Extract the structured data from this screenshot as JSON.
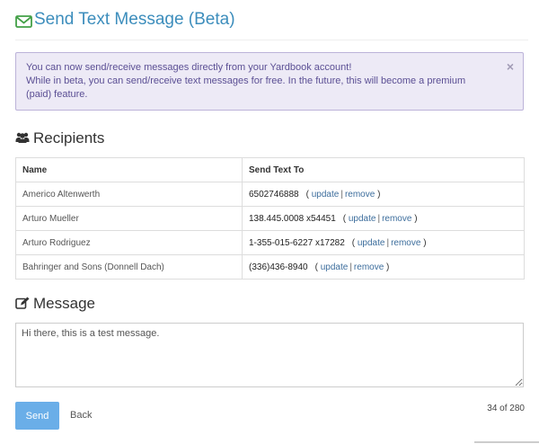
{
  "header": {
    "title": "Send Text Message (Beta)",
    "icon": "envelope-icon",
    "icon_color": "#43a047",
    "title_color": "#3c8dbc"
  },
  "alert": {
    "lines": [
      "You can now send/receive messages directly from your Yardbook account!",
      "While in beta, you can send/receive text messages for free. In the future, this will become a premium (paid) feature."
    ],
    "close_symbol": "×",
    "background": "#edeaf6",
    "text_color": "#5b4f94"
  },
  "recipients": {
    "title": "Recipients",
    "icon": "users-icon",
    "columns": [
      "Name",
      "Send Text To"
    ],
    "update_label": "update",
    "remove_label": "remove",
    "rows": [
      {
        "name": "Americo Altenwerth",
        "phone": "6502746888"
      },
      {
        "name": "Arturo Mueller",
        "phone": "138.445.0008 x54451"
      },
      {
        "name": "Arturo Rodriguez",
        "phone": "1-355-015-6227 x17282"
      },
      {
        "name": "Bahringer and Sons (Donnell Dach)",
        "phone": "(336)436-8940"
      }
    ]
  },
  "message": {
    "title": "Message",
    "icon": "edit-icon",
    "value": "Hi there, this is a test message.",
    "char_count": "34 of 280"
  },
  "actions": {
    "send_label": "Send",
    "back_label": "Back",
    "send_color": "#6aaee8"
  }
}
